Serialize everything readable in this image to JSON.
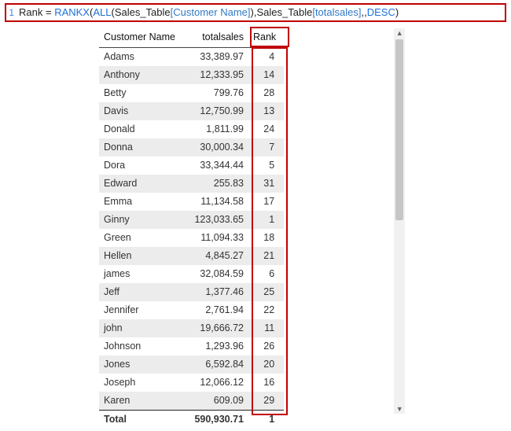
{
  "formula": {
    "line_num": "1",
    "result_name": "Rank",
    "fn1": "RANKX",
    "fn2": "ALL",
    "arg1_table": "Sales_Table",
    "arg1_col": "Customer Name",
    "arg2_table": "Sales_Table",
    "arg2_col": "totalsales",
    "order": "DESC"
  },
  "headers": {
    "name": "Customer Name",
    "sales": "totalsales",
    "rank": "Rank"
  },
  "rows": [
    {
      "name": "Adams",
      "sales": "33,389.97",
      "rank": "4"
    },
    {
      "name": "Anthony",
      "sales": "12,333.95",
      "rank": "14"
    },
    {
      "name": "Betty",
      "sales": "799.76",
      "rank": "28"
    },
    {
      "name": "Davis",
      "sales": "12,750.99",
      "rank": "13"
    },
    {
      "name": "Donald",
      "sales": "1,811.99",
      "rank": "24"
    },
    {
      "name": "Donna",
      "sales": "30,000.34",
      "rank": "7"
    },
    {
      "name": "Dora",
      "sales": "33,344.44",
      "rank": "5"
    },
    {
      "name": "Edward",
      "sales": "255.83",
      "rank": "31"
    },
    {
      "name": "Emma",
      "sales": "11,134.58",
      "rank": "17"
    },
    {
      "name": "Ginny",
      "sales": "123,033.65",
      "rank": "1"
    },
    {
      "name": "Green",
      "sales": "11,094.33",
      "rank": "18"
    },
    {
      "name": "Hellen",
      "sales": "4,845.27",
      "rank": "21"
    },
    {
      "name": "james",
      "sales": "32,084.59",
      "rank": "6"
    },
    {
      "name": "Jeff",
      "sales": "1,377.46",
      "rank": "25"
    },
    {
      "name": "Jennifer",
      "sales": "2,761.94",
      "rank": "22"
    },
    {
      "name": "john",
      "sales": "19,666.72",
      "rank": "11"
    },
    {
      "name": "Johnson",
      "sales": "1,293.96",
      "rank": "26"
    },
    {
      "name": "Jones",
      "sales": "6,592.84",
      "rank": "20"
    },
    {
      "name": "Joseph",
      "sales": "12,066.12",
      "rank": "16"
    },
    {
      "name": "Karen",
      "sales": "609.09",
      "rank": "29"
    }
  ],
  "total": {
    "label": "Total",
    "sales": "590,930.71",
    "rank": "1"
  }
}
